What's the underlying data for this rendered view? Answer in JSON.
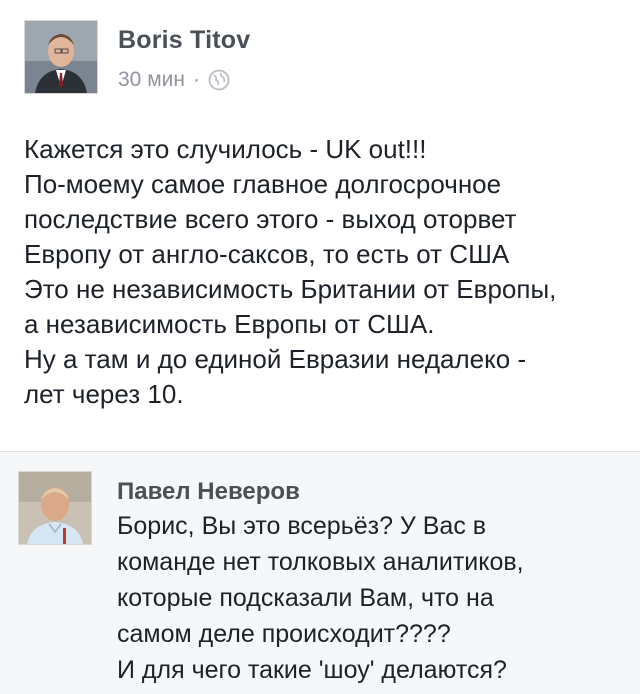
{
  "post": {
    "author": "Boris Titov",
    "time": "30 мин",
    "separator": "·",
    "privacy_icon": "globe-icon",
    "lines": [
      "Кажется это случилось - UK out!!!",
      "По-моему самое главное долгосрочное",
      "последствие всего этого - выход оторвет",
      "Европу от англо-саксов, то есть от США",
      "Это не независимость Британии от Европы,",
      "а независимость Европы от США.",
      "Ну а там и до единой Евразии недалеко -",
      "лет через 10."
    ]
  },
  "comment": {
    "author": "Павел Неверов",
    "lines": [
      "Борис, Вы это всерьёз? У Вас в",
      "команде нет толковых аналитиков,",
      "которые подсказали Вам, что на",
      "самом деле происходит????",
      "И для чего такие 'шоу' делаются?"
    ]
  },
  "colors": {
    "author": "#4b4f56",
    "meta": "#90949c",
    "text": "#1d2129",
    "comment_bg": "#f6f7f9"
  }
}
